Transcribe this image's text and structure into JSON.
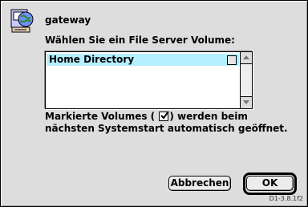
{
  "dialog": {
    "server_name": "gateway",
    "prompt": "Wählen Sie ein File Server Volume:",
    "volumes": [
      {
        "label": "Home Directory",
        "selected": true,
        "auto_open": false
      }
    ],
    "note_before": "Markierte Volumes (",
    "note_after": ") werden beim",
    "note_line2": "nächsten Systemstart automatisch geöffnet.",
    "cancel_label": "Abbrechen",
    "ok_label": "OK",
    "version": "D1-3.8.1f2"
  },
  "icons": {
    "server": "appleshare-server-icon",
    "checkbox": "checkmark-icon"
  },
  "colors": {
    "selection": "#b4f0ff",
    "dialog_bg": "#dddddd"
  }
}
